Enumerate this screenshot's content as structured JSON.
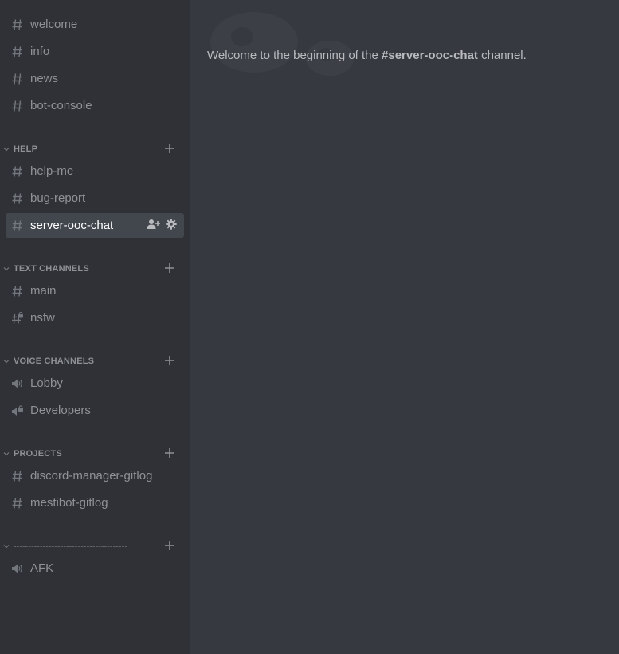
{
  "sidebar": {
    "top_channels": [
      {
        "label": "welcome",
        "icon": "hash-icon"
      },
      {
        "label": "info",
        "icon": "hash-icon"
      },
      {
        "label": "news",
        "icon": "hash-icon"
      },
      {
        "label": "bot-console",
        "icon": "hash-icon"
      }
    ],
    "categories": [
      {
        "name": "HELP",
        "channels": [
          {
            "label": "help-me",
            "icon": "hash-icon"
          },
          {
            "label": "bug-report",
            "icon": "hash-icon"
          },
          {
            "label": "server-ooc-chat",
            "icon": "hash-icon",
            "selected": true
          }
        ]
      },
      {
        "name": "TEXT CHANNELS",
        "channels": [
          {
            "label": "main",
            "icon": "hash-icon"
          },
          {
            "label": "nsfw",
            "icon": "locked-hash-icon"
          }
        ]
      },
      {
        "name": "VOICE CHANNELS",
        "channels": [
          {
            "label": "Lobby",
            "icon": "speaker-icon"
          },
          {
            "label": "Developers",
            "icon": "locked-speaker-icon"
          }
        ]
      },
      {
        "name": "PROJECTS",
        "channels": [
          {
            "label": "discord-manager-gitlog",
            "icon": "hash-icon"
          },
          {
            "label": "mestibot-gitlog",
            "icon": "hash-icon"
          }
        ]
      },
      {
        "name": "---------------------------------------",
        "channels": [
          {
            "label": "AFK",
            "icon": "speaker-icon"
          }
        ]
      }
    ]
  },
  "main": {
    "welcome_prefix": "Welcome to the beginning of the ",
    "welcome_channel": "#server-ooc-chat",
    "welcome_suffix": " channel."
  },
  "colors": {
    "sidebar_bg": "#2f3136",
    "main_bg": "#36393f",
    "selected_bg": "#42464d",
    "muted_text": "#8e9297"
  }
}
